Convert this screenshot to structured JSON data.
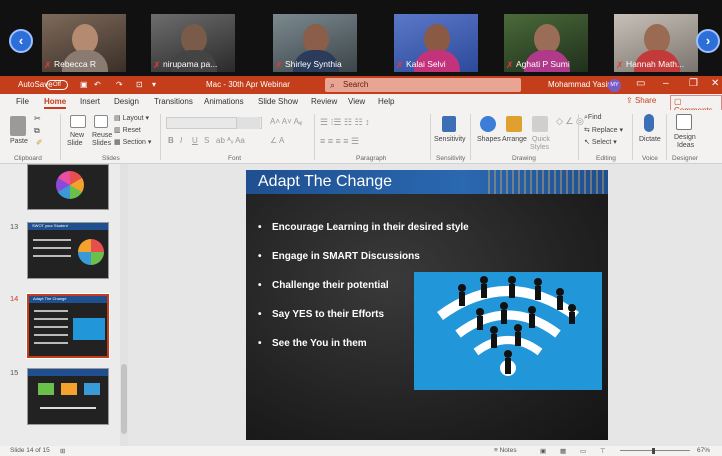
{
  "video_strip": {
    "participants": [
      {
        "name": "Rebecca R"
      },
      {
        "name": "nirupama pa..."
      },
      {
        "name": "Shirley Synthia"
      },
      {
        "name": "Kalai Selvi"
      },
      {
        "name": "Aghati P Sumi"
      },
      {
        "name": "Hannah Math..."
      }
    ],
    "prev_arrow": "‹",
    "next_arrow": "›"
  },
  "titlebar": {
    "autosave_label": "AutoSave",
    "autosave_state": "Off",
    "doc_title": "Mac - 30th Apr Webinar",
    "search_placeholder": "Search",
    "user_name": "Mohammad Yasin",
    "user_initials": "MY",
    "accent": "#c43e1c"
  },
  "tabs": [
    "File",
    "Home",
    "Insert",
    "Design",
    "Transitions",
    "Animations",
    "Slide Show",
    "Review",
    "View",
    "Help"
  ],
  "active_tab": "Home",
  "share_label": "Share",
  "comments_label": "Comments",
  "ribbon": {
    "clipboard": {
      "paste": "Paste",
      "group": "Clipboard"
    },
    "slides": {
      "new_slide": "New",
      "new_slide2": "Slide",
      "reuse": "Reuse",
      "reuse2": "Slides",
      "layout": "Layout",
      "reset": "Reset",
      "section": "Section",
      "group": "Slides"
    },
    "font": {
      "group": "Font",
      "bold": "B",
      "italic": "I",
      "underline": "U",
      "strike": "S"
    },
    "paragraph": {
      "group": "Paragraph"
    },
    "sensitivity": {
      "label": "Sensitivity",
      "group": "Sensitivity"
    },
    "drawing": {
      "shapes": "Shapes",
      "arrange": "Arrange",
      "quick_styles": "Quick",
      "quick_styles2": "Styles",
      "group": "Drawing"
    },
    "editing": {
      "find": "Find",
      "replace": "Replace",
      "select": "Select",
      "group": "Editing"
    },
    "voice": {
      "dictate": "Dictate",
      "group": "Voice"
    },
    "designer": {
      "ideas": "Design",
      "ideas2": "Ideas",
      "group": "Designer"
    }
  },
  "thumbnails": [
    {
      "number": "",
      "title": ""
    },
    {
      "number": "13",
      "title": "SWOT your Student"
    },
    {
      "number": "14",
      "title": "Adapt The Change"
    },
    {
      "number": "15",
      "title": ""
    }
  ],
  "slide": {
    "title": "Adapt The Change",
    "bullets": [
      "Encourage Learning in their desired style",
      "Engage in SMART Discussions",
      "Challenge their potential",
      "Say YES to their Efforts",
      "See the You in them"
    ]
  },
  "statusbar": {
    "slide_count": "Slide 14 of 15",
    "notes": "Notes",
    "zoom": "67%"
  }
}
